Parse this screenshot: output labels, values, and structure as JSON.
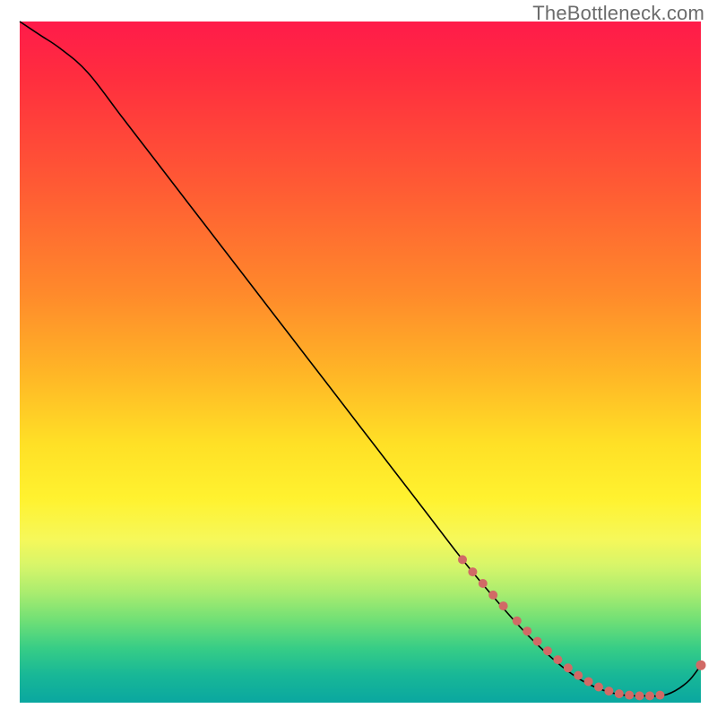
{
  "watermark": "TheBottleneck.com",
  "colors": {
    "curve": "#000000",
    "markers": "#d16a66",
    "gradient_top": "#ff1b4a",
    "gradient_mid": "#fff22f",
    "gradient_green": "#37cd86",
    "gradient_bottom": "#0aa7a0"
  },
  "chart_data": {
    "type": "line",
    "title": "",
    "xlabel": "",
    "ylabel": "",
    "xlim": [
      0,
      100
    ],
    "ylim": [
      0,
      100
    ],
    "series": [
      {
        "name": "bottleneck-curve",
        "x": [
          0,
          3,
          6,
          10,
          15,
          20,
          25,
          30,
          35,
          40,
          45,
          50,
          55,
          60,
          65,
          70,
          75,
          80,
          84,
          88,
          92,
          95,
          98,
          100
        ],
        "y": [
          100,
          98,
          96,
          92.5,
          86,
          79.5,
          73,
          66.5,
          60,
          53.5,
          47,
          40.5,
          34,
          27.5,
          21,
          15,
          9.5,
          5,
          2.5,
          1.2,
          1,
          1.2,
          3,
          5.5
        ]
      }
    ],
    "markers": {
      "name": "highlighted-points",
      "comment": "Salmon dots along the lower portion of the curve",
      "points_xy": [
        [
          65,
          21
        ],
        [
          66.5,
          19.2
        ],
        [
          68,
          17.5
        ],
        [
          69.5,
          15.8
        ],
        [
          71,
          14.2
        ],
        [
          73,
          12
        ],
        [
          74.5,
          10.5
        ],
        [
          76,
          9
        ],
        [
          77.5,
          7.6
        ],
        [
          79,
          6.3
        ],
        [
          80.5,
          5.1
        ],
        [
          82,
          4
        ],
        [
          83.5,
          3.1
        ],
        [
          85,
          2.3
        ],
        [
          86.5,
          1.7
        ],
        [
          88,
          1.3
        ],
        [
          89.5,
          1.1
        ],
        [
          91,
          1.0
        ],
        [
          92.5,
          1.0
        ],
        [
          94,
          1.1
        ],
        [
          100,
          5.5
        ]
      ]
    },
    "legend": null,
    "grid": false
  }
}
